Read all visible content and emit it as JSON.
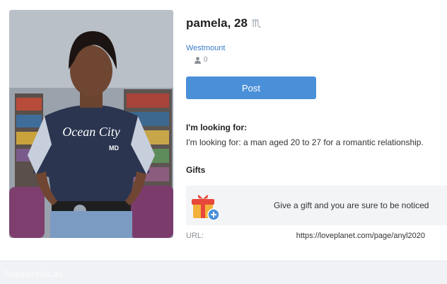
{
  "profile": {
    "name_age": "pamela, 28",
    "zodiac_symbol": "♏",
    "zodiac_icon": "scorpio-icon",
    "city": "Westmount",
    "friends_count": "0",
    "friends_icon": "user-icon"
  },
  "actions": {
    "post_label": "Post"
  },
  "looking_for": {
    "title": "I'm looking for:",
    "text": "I'm looking for: a man aged 20 to 27 for a romantic relationship."
  },
  "gifts": {
    "title": "Gifts",
    "icon": "gift-add-icon",
    "prompt": "Give a gift and you are sure to be noticed"
  },
  "url": {
    "label": "URL:",
    "value": "https://loveplanet.com/page/anyl2020"
  },
  "footer": {
    "watermark": "Scamerslist.de"
  },
  "photo": {
    "shirt_text": "Ocean City",
    "shirt_badge": "MD"
  },
  "colors": {
    "accent": "#4a90d9",
    "link": "#3a7bc8",
    "gift_bg": "#f3f4f6"
  }
}
